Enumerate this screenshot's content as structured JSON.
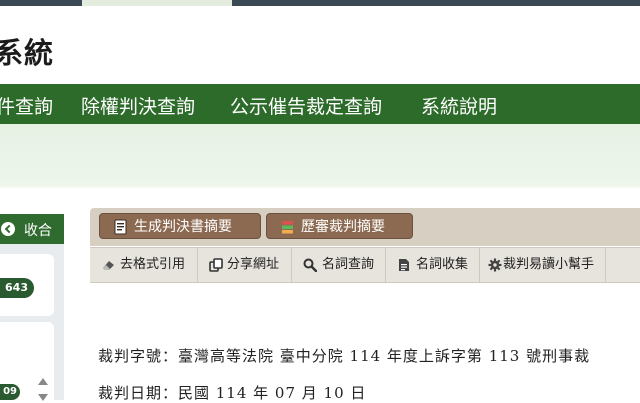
{
  "header": {
    "site_title": "系統"
  },
  "nav": {
    "items": [
      {
        "label": "件查詢"
      },
      {
        "label": "除權判決查詢"
      },
      {
        "label": "公示催告裁定查詢"
      },
      {
        "label": "系統說明"
      }
    ]
  },
  "sidebar": {
    "collapse_label": "收合",
    "badge_top": "643",
    "badge_bottom": "09"
  },
  "toolbar": {
    "generate_summary": "生成判決書摘要",
    "history_summary": "歷審裁判摘要"
  },
  "subtoolbar": {
    "remove_format": "去格式引用",
    "share_url": "分享網址",
    "term_query": "名詞查詢",
    "term_collect": "名詞收集",
    "reading_helper": "裁判易讀小幫手"
  },
  "document": {
    "case_number": "裁判字號：臺灣高等法院 臺中分院 114 年度上訴字第 113 號刑事裁",
    "judgment_date": "裁判日期：民國 114 年 07 月 10 日"
  },
  "icons": {
    "collapse": "chevron-left-circle-icon",
    "generate": "document-icon",
    "history": "books-icon",
    "eraser": "eraser-icon",
    "share": "share-link-icon",
    "search": "search-icon",
    "collect": "document-list-icon",
    "gear": "gear-icon"
  },
  "colors": {
    "nav_bg": "#2d6b2a",
    "hero_bg": "#e6f1e4",
    "toolbar_button": "#8c6a52",
    "badge": "#2a5a2f"
  }
}
